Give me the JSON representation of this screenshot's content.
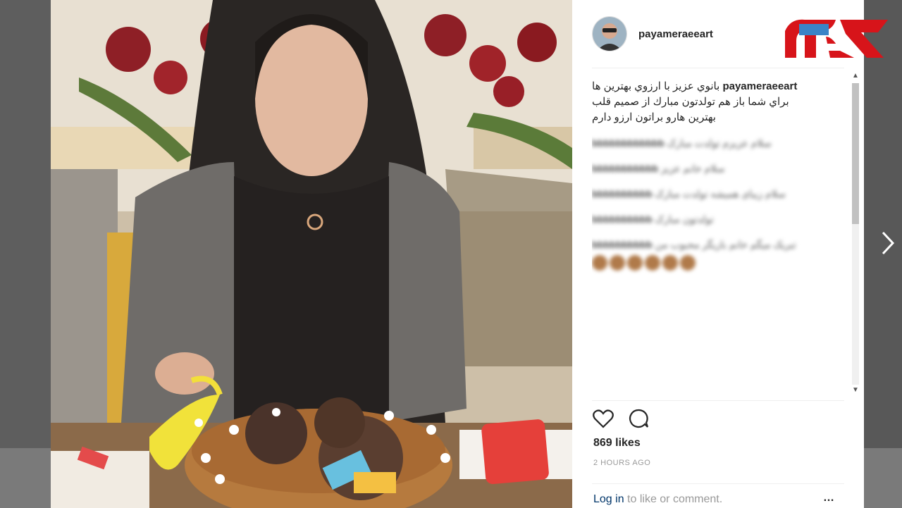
{
  "post": {
    "username": "payameraeeart",
    "caption": {
      "user": "payameraeeart",
      "lines": [
        "بانوي عزيز با ارزوي بهترين ها",
        "براي شما باز هم تولدتون مبارك از صميم قلب",
        "بهترين هارو براتون ارزو دارم"
      ]
    },
    "blurred_comments": [
      {
        "user": "bbbbbbbbbbbb",
        "text": "سلام عزیزم تولدت مبارک"
      },
      {
        "user": "bbbbbbbbbbb",
        "text": "سلام خانم عزیز"
      },
      {
        "user": "bbbbbbbbbb",
        "text": "سلام زیبای همیشه تولدت مبارک"
      },
      {
        "user": "bbbbbbbbbb",
        "text": "تولدتون مبارک"
      },
      {
        "user": "bbbbbbbbbb",
        "text": "تبریک میگم خانم بازیگر محبوب من"
      }
    ],
    "likes": "869 likes",
    "time_ago": "2 HOURS AGO",
    "login_link": "Log in",
    "login_suffix": " to like or comment.",
    "more_label": "…"
  },
  "brand": {
    "name": "rokna-logo"
  },
  "colors": {
    "brand_red": "#d7141a",
    "link": "#003569"
  }
}
